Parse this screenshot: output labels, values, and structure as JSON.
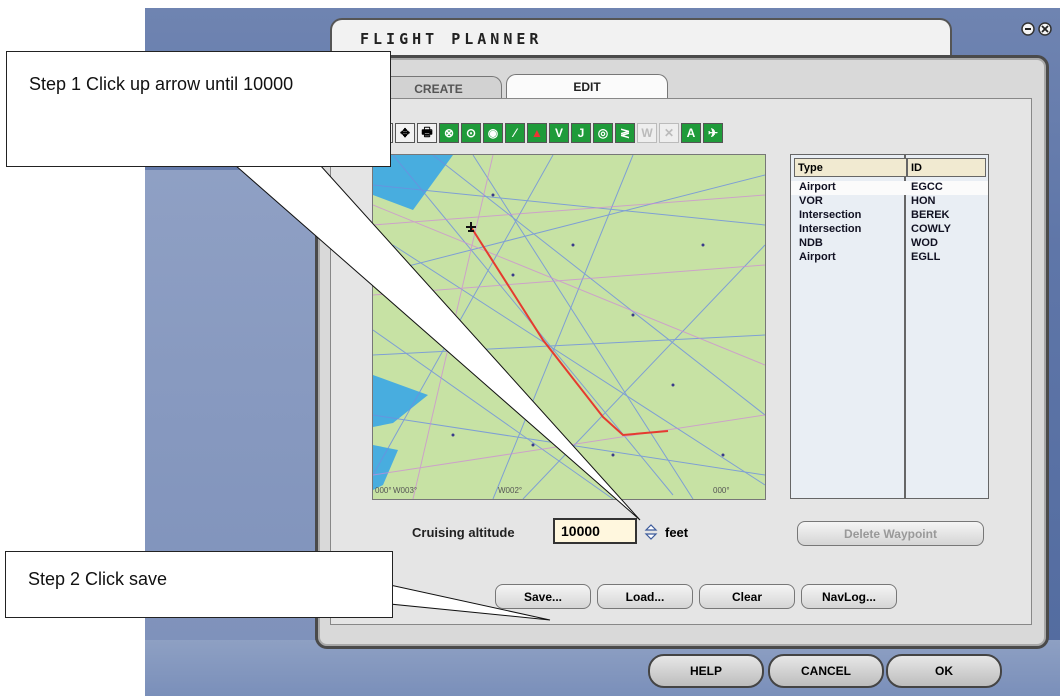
{
  "window": {
    "title": "FLIGHT PLANNER"
  },
  "tabs": [
    {
      "label": "CREATE",
      "active": false
    },
    {
      "label": "EDIT",
      "active": true
    }
  ],
  "toolbar": {
    "icons": [
      "zoom-icon",
      "center-map-icon",
      "print-icon",
      "airport-icon",
      "vor-icon",
      "ndb-icon",
      "route-icon",
      "terrain-icon",
      "victor-airways-label",
      "jet-airways-label",
      "intersection-icon",
      "track-icon",
      "waypoint-disabled-icon",
      "delete-waypoint-disabled-icon",
      "labels-icon",
      "map-options-icon"
    ],
    "labels": {
      "victor": "V",
      "jet": "J",
      "labels": "A"
    }
  },
  "map": {
    "longitude_labels": [
      "000°",
      "W003°",
      "W002°",
      "000°"
    ]
  },
  "waypoints": {
    "headers": {
      "type": "Type",
      "id": "ID"
    },
    "rows": [
      {
        "type": "Airport",
        "id": "EGCC"
      },
      {
        "type": "VOR",
        "id": "HON"
      },
      {
        "type": "Intersection",
        "id": "BEREK"
      },
      {
        "type": "Intersection",
        "id": "COWLY"
      },
      {
        "type": "NDB",
        "id": "WOD"
      },
      {
        "type": "Airport",
        "id": "EGLL"
      }
    ]
  },
  "altitude": {
    "label": "Cruising altitude",
    "value": "10000",
    "unit": "feet"
  },
  "buttons": {
    "delete": "Delete Waypoint",
    "save": "Save...",
    "load": "Load...",
    "clear": "Clear",
    "navlog": "NavLog..."
  },
  "bottom": {
    "help": "HELP",
    "cancel": "CANCEL",
    "ok": "OK"
  },
  "annotations": {
    "step1": "Step 1 Click up arrow until 10000",
    "step2": "Step 2 Click save"
  },
  "colors": {
    "route": "#e53b2f",
    "map_land": "#c7e2a4",
    "map_water": "#3aa7e6",
    "airways_blue": "#6d8fe0",
    "airways_pink": "#cf88d8"
  }
}
